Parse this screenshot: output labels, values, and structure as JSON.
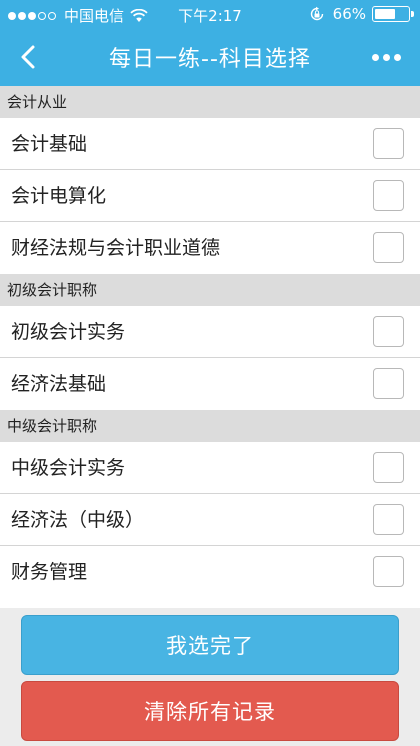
{
  "status_bar": {
    "carrier": "中国电信",
    "time": "下午2:17",
    "battery_percent": "66%",
    "battery_level": 0.66,
    "signal_bars_filled": 3,
    "signal_bars_total": 5,
    "text_color": "#ffffff"
  },
  "nav": {
    "title": "每日一练--科目选择",
    "back_icon": "chevron-left-icon",
    "more_icon": "more-dots-icon",
    "background_color": "#3db0e3"
  },
  "sections": [
    {
      "header": "会计从业",
      "items": [
        {
          "label": "会计基础",
          "checked": false
        },
        {
          "label": "会计电算化",
          "checked": false
        },
        {
          "label": "财经法规与会计职业道德",
          "checked": false
        }
      ]
    },
    {
      "header": "初级会计职称",
      "items": [
        {
          "label": "初级会计实务",
          "checked": false
        },
        {
          "label": "经济法基础",
          "checked": false
        }
      ]
    },
    {
      "header": "中级会计职称",
      "items": [
        {
          "label": "中级会计实务",
          "checked": false
        },
        {
          "label": "经济法（中级）",
          "checked": false
        },
        {
          "label": "财务管理",
          "checked": false
        }
      ]
    }
  ],
  "buttons": {
    "done_label": "我选完了",
    "clear_label": "清除所有记录",
    "done_color": "#48b4e3",
    "clear_color": "#e35a4f"
  }
}
